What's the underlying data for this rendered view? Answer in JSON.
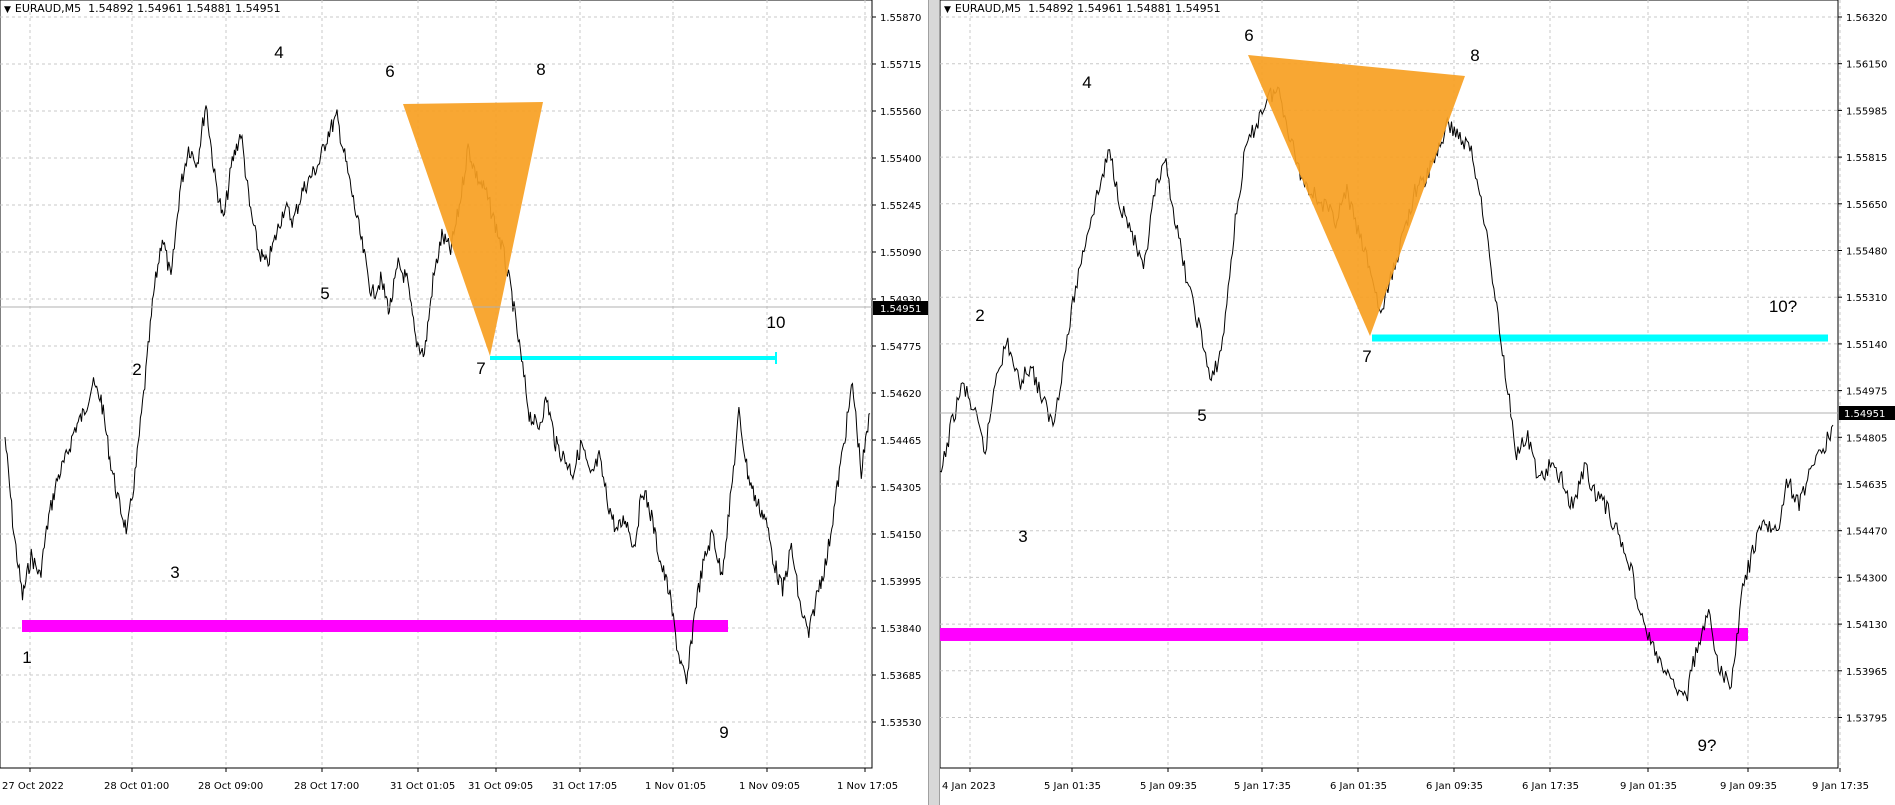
{
  "colors": {
    "price": "#000000",
    "triangle": "#F7A022",
    "support": "#FF00FF",
    "level": "#00FFFF",
    "grid": "#c8c8c8",
    "current_bg": "#000000"
  },
  "charts": [
    {
      "header": {
        "symbol": "EURAUD,M5",
        "ohlc": "1.54892 1.54961 1.54881 1.54951"
      },
      "current_price": "1.54951",
      "price_labels": [
        "1.55870",
        "1.55715",
        "1.55560",
        "1.55400",
        "1.55245",
        "1.55090",
        "1.54930",
        "1.54775",
        "1.54620",
        "1.54465",
        "1.54305",
        "1.54150",
        "1.53995",
        "1.53840",
        "1.53685",
        "1.53530"
      ],
      "time_labels": [
        "27 Oct 2022",
        "28 Oct 01:00",
        "28 Oct 09:00",
        "28 Oct 17:00",
        "31 Oct 01:05",
        "31 Oct 09:05",
        "31 Oct 17:05",
        "1 Nov 01:05",
        "1 Nov 09:05",
        "1 Nov 17:05"
      ],
      "wave_labels": [
        "1",
        "2",
        "3",
        "4",
        "5",
        "6",
        "7",
        "8",
        "9",
        "10"
      ],
      "chart_data": {
        "type": "line",
        "title": "EURAUD,M5",
        "ylim": [
          1.5345,
          1.5595
        ],
        "series": [
          {
            "values": [
              1.5452,
              1.542,
              1.5398,
              1.5412,
              1.5405,
              1.5425,
              1.5438,
              1.5445,
              1.5455,
              1.546,
              1.547,
              1.5465,
              1.5445,
              1.543,
              1.542,
              1.5442,
              1.547,
              1.55,
              1.552,
              1.5505,
              1.5535,
              1.555,
              1.5545,
              1.5565,
              1.554,
              1.5525,
              1.5545,
              1.5555,
              1.553,
              1.5515,
              1.551,
              1.552,
              1.553,
              1.5525,
              1.5535,
              1.554,
              1.5545,
              1.5555,
              1.556,
              1.5545,
              1.553,
              1.5515,
              1.55,
              1.5505,
              1.5495,
              1.551,
              1.5505,
              1.5485,
              1.548,
              1.5505,
              1.552,
              1.5515,
              1.553,
              1.555,
              1.554,
              1.5535,
              1.5525,
              1.5515,
              1.55,
              1.548,
              1.546,
              1.5455,
              1.5465,
              1.545,
              1.5445,
              1.544,
              1.545,
              1.5438,
              1.5445,
              1.543,
              1.542,
              1.5425,
              1.5415,
              1.5435,
              1.5425,
              1.541,
              1.54,
              1.538,
              1.5368,
              1.5395,
              1.541,
              1.542,
              1.5405,
              1.543,
              1.546,
              1.544,
              1.543,
              1.5425,
              1.541,
              1.54,
              1.5415,
              1.5395,
              1.5385,
              1.54,
              1.541,
              1.543,
              1.545,
              1.547,
              1.544,
              1.546
            ]
          }
        ]
      }
    },
    {
      "header": {
        "symbol": "EURAUD,M5",
        "ohlc": "1.54892 1.54961 1.54881 1.54951"
      },
      "current_price": "1.54951",
      "price_labels": [
        "1.56320",
        "1.56150",
        "1.55985",
        "1.55815",
        "1.55650",
        "1.55480",
        "1.55310",
        "1.55140",
        "1.54975",
        "1.54805",
        "1.54635",
        "1.54470",
        "1.54300",
        "1.54130",
        "1.53965",
        "1.53795"
      ],
      "time_labels": [
        "4 Jan 2023",
        "5 Jan 01:35",
        "5 Jan 09:35",
        "5 Jan 17:35",
        "6 Jan 01:35",
        "6 Jan 09:35",
        "6 Jan 17:35",
        "9 Jan 01:35",
        "9 Jan 09:35",
        "9 Jan 17:35"
      ],
      "wave_labels": [
        "2",
        "3",
        "4",
        "5",
        "6",
        "7",
        "8",
        "9?",
        "10?"
      ],
      "chart_data": {
        "type": "line",
        "title": "EURAUD,M5",
        "ylim": [
          1.537,
          1.564
        ],
        "series": [
          {
            "values": [
              1.547,
              1.549,
              1.5505,
              1.5495,
              1.548,
              1.551,
              1.552,
              1.5505,
              1.5512,
              1.55,
              1.549,
              1.5515,
              1.554,
              1.556,
              1.5575,
              1.559,
              1.557,
              1.556,
              1.5545,
              1.5575,
              1.5585,
              1.556,
              1.554,
              1.5525,
              1.5505,
              1.552,
              1.556,
              1.559,
              1.56,
              1.561,
              1.5612,
              1.5595,
              1.558,
              1.5575,
              1.557,
              1.5565,
              1.5575,
              1.556,
              1.5548,
              1.553,
              1.5545,
              1.556,
              1.5575,
              1.558,
              1.559,
              1.56,
              1.5595,
              1.559,
              1.557,
              1.554,
              1.551,
              1.548,
              1.5485,
              1.547,
              1.5475,
              1.547,
              1.546,
              1.5475,
              1.5465,
              1.546,
              1.545,
              1.544,
              1.542,
              1.541,
              1.54,
              1.5395,
              1.539,
              1.541,
              1.542,
              1.54,
              1.5395,
              1.543,
              1.5445,
              1.5455,
              1.545,
              1.547,
              1.546,
              1.5475,
              1.548,
              1.549
            ]
          }
        ]
      }
    }
  ]
}
